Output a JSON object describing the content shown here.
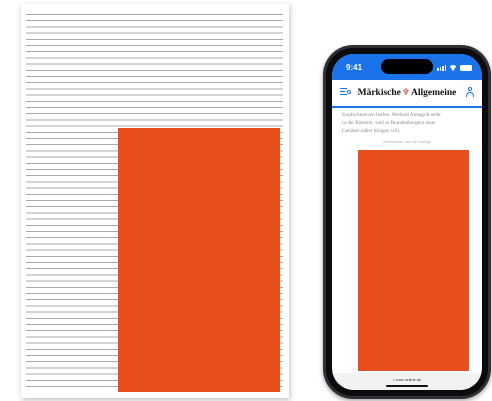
{
  "print_page": {
    "ad_color": "#e74f1c"
  },
  "phone": {
    "status_bar": {
      "time": "9:41",
      "icons": [
        "signal-icon",
        "wifi-icon",
        "battery-icon"
      ],
      "color": "#1a73e8"
    },
    "header": {
      "menu_icon": "menu-search-icon",
      "logo_left": "Märkische",
      "logo_right": "Allgemeine",
      "logo_crest": "♆",
      "account_icon": "account-icon"
    },
    "article": {
      "lines": [
        "Kopfschmerzen helfen. Weiland Almagrüt steht",
        "in der Rösterei, weil er Brandenburgern neue",
        "Genüsse näher bringen will."
      ]
    },
    "ad": {
      "label": "Werbebanner nach der Anzeige",
      "color": "#e74f1c"
    },
    "url_bar": {
      "url": "⌂ maz-online.de"
    }
  }
}
